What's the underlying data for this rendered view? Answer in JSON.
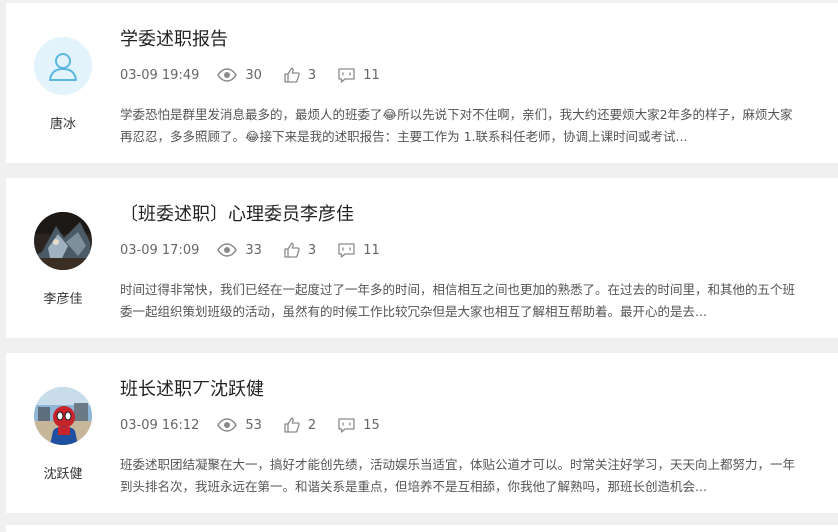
{
  "posts": [
    {
      "title": "学委述职报告",
      "date": "03-09 19:49",
      "views": "30",
      "likes": "3",
      "comments": "11",
      "author": "唐冰",
      "avatar": "default-user-icon",
      "excerpt_line1": "学委恐怕是群里发消息最多的，最烦人的班委了😂所以先说下对不住啊，亲们，我大约还要烦大家2年多的样子，麻烦大家",
      "excerpt_line2": "再忍忍，多多照顾了。😂接下来是我的述职报告：主要工作为 1.联系科任老师，协调上课时间或考试..."
    },
    {
      "title": "〔班委述职〕心理委员李彦佳",
      "date": "03-09 17:09",
      "views": "33",
      "likes": "3",
      "comments": "11",
      "author": "李彦佳",
      "avatar": "photo-avatar",
      "excerpt_line1": "时间过得非常快，我们已经在一起度过了一年多的时间，相信相互之间也更加的熟悉了。在过去的时间里，和其他的五个班",
      "excerpt_line2": "委一起组织策划班级的活动，虽然有的时候工作比较冗杂但是大家也相互了解相互帮助着。最开心的是去..."
    },
    {
      "title": "班长述职丆沈跃健",
      "date": "03-09 16:12",
      "views": "53",
      "likes": "2",
      "comments": "15",
      "author": "沈跃健",
      "avatar": "spiderman-avatar",
      "excerpt_line1": "班委述职团结凝聚在大一，搞好才能创先绩，活动娱乐当适宜，体贴公道才可以。时常关注好学习，天天向上都努力，一年",
      "excerpt_line2": "到头排名次，我班永远在第一。和谐关系是重点，但培养不是互相舔，你我他了解熟吗，那班长创造机会..."
    }
  ],
  "icons": {
    "views": "eye-icon",
    "likes": "thumbs-up-icon",
    "comments": "comment-icon"
  },
  "colors": {
    "icon": "#8a8a8a",
    "avatar_bg": "#e3f3fb",
    "avatar_icon": "#59b7e0"
  }
}
